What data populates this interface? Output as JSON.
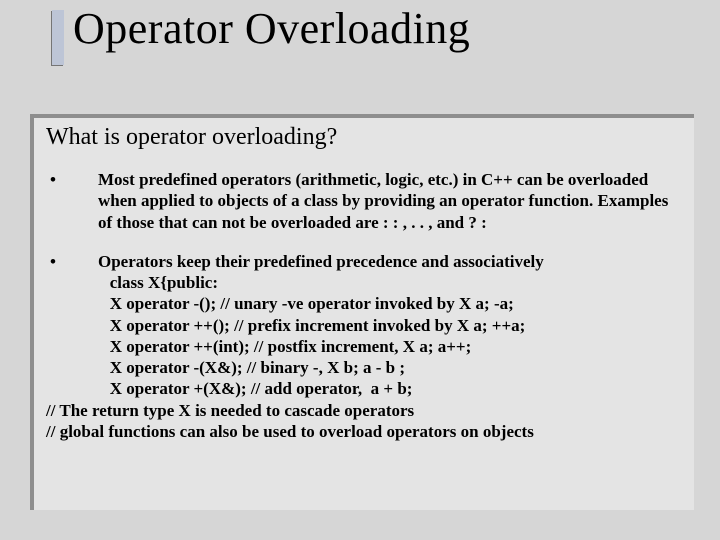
{
  "title": "Operator Overloading",
  "subtitle": "What is operator overloading?",
  "para1": "Most predefined operators (arithmetic, logic, etc.) in C++ can be overloaded when applied to objects of  a class by providing an operator function. Examples of those that can not  be overloaded are : : , . . ,  and ? :",
  "para2_lead": "Operators keep their predefined precedence and associatively",
  "code_lines": [
    "class X{public:",
    "X operator -(); // unary -ve operator invoked by X a; -a;",
    "X operator ++(); // prefix increment invoked by X a; ++a;",
    "X operator ++(int); // postfix increment, X a; a++;",
    "X operator -(X&); // binary -, X b; a - b ;",
    "X operator +(X&); // add operator,  a + b;"
  ],
  "tail1": "// The return type X is needed to cascade operators",
  "tail2": "// global functions can also be used to overload operators on objects",
  "bullet": "•"
}
